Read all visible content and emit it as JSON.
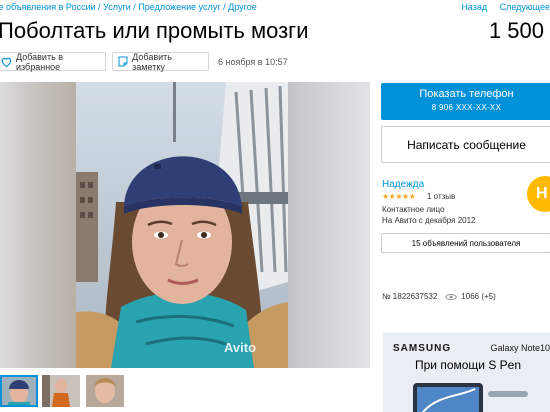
{
  "breadcrumbs": {
    "item1": "се объявления в России",
    "item2": "Услуги",
    "item3": "Предложение услуг",
    "item4": "Другое",
    "separator": "/"
  },
  "topnav": {
    "back": "Назад",
    "next": "Следующее"
  },
  "listing": {
    "title": "Поболтать или промыть мозги",
    "price": "1 500",
    "date": "6 ноября в 10:57",
    "number": "№ 1822637532",
    "views": "1066 (+5)"
  },
  "actions": {
    "favorite_label": "Добавить в избранное",
    "note_label": "Добавить заметку"
  },
  "gallery": {
    "watermark": "Avito",
    "thumb_count": 3,
    "selected_thumb": 1
  },
  "contact": {
    "phone_label": "Показать телефон",
    "phone_number": "8 906 XXX-XX-XX",
    "message_label": "Написать сообщение"
  },
  "seller": {
    "name": "Надежда",
    "stars": "★★★★★",
    "rating": 5,
    "reviews": "1 отзыв",
    "contact_label": "Контактное лицо",
    "since": "На Авито с декабря 2012",
    "ads_button": "15 объявлений пользователя",
    "avatar_letter": "Н"
  },
  "ad": {
    "brand": "SAMSUNG",
    "model": "Galaxy Note10",
    "tagline": "При помощи S Pen"
  },
  "colors": {
    "accent": "#0091d9",
    "avatar": "#ffba00",
    "stars": "#f5a623"
  },
  "icons": {
    "favorite": "heart-outline-icon",
    "note": "note-icon",
    "views": "eye-icon"
  }
}
